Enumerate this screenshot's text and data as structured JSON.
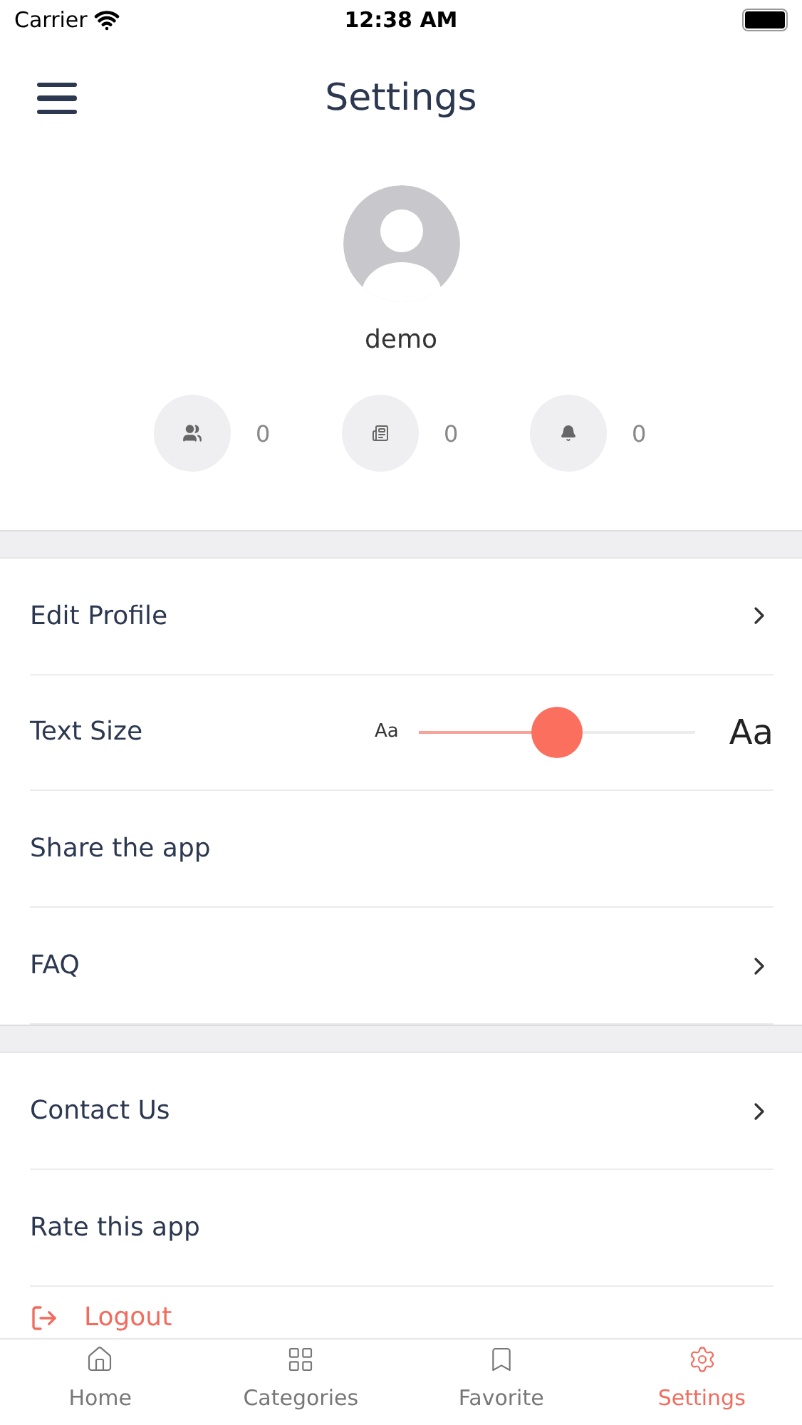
{
  "status_bar": {
    "carrier": "Carrier",
    "time": "12:38 AM"
  },
  "header": {
    "title": "Settings"
  },
  "profile": {
    "name": "demo",
    "stats": [
      {
        "kind": "users",
        "count": "0"
      },
      {
        "kind": "news",
        "count": "0"
      },
      {
        "kind": "bell",
        "count": "0"
      }
    ]
  },
  "sections": [
    {
      "items": [
        {
          "kind": "link",
          "label": "Edit Profile"
        },
        {
          "kind": "slider",
          "label": "Text Size",
          "small_label": "Aa",
          "large_label": "Aa",
          "level": 0.5
        },
        {
          "kind": "plain",
          "label": "Share the app"
        },
        {
          "kind": "link",
          "label": "FAQ"
        }
      ]
    },
    {
      "items": [
        {
          "kind": "link",
          "label": "Contact Us"
        },
        {
          "kind": "plain",
          "label": "Rate this app"
        },
        {
          "kind": "logout",
          "label": "Logout"
        }
      ]
    }
  ],
  "tabs": [
    {
      "kind": "home",
      "label": "Home",
      "selected": false
    },
    {
      "kind": "grid",
      "label": "Categories",
      "selected": false
    },
    {
      "kind": "bookmark",
      "label": "Favorite",
      "selected": false
    },
    {
      "kind": "gear",
      "label": "Settings",
      "selected": true
    }
  ]
}
